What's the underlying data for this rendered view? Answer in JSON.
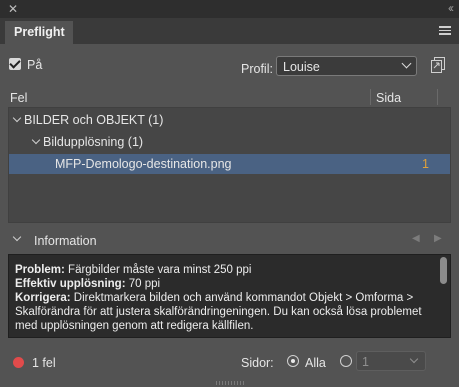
{
  "panel": {
    "tab_title": "Preflight"
  },
  "controls": {
    "on_label": "På",
    "profile_label": "Profil:",
    "profile_value": "Louise"
  },
  "table": {
    "col_error": "Fel",
    "col_page": "Sida",
    "rows": [
      {
        "label": "BILDER och OBJEKT (1)",
        "page": ""
      },
      {
        "label": "Bildupplösning (1)",
        "page": ""
      },
      {
        "label": "MFP-Demologo-destination.png",
        "page": "1"
      }
    ]
  },
  "info": {
    "title": "Information",
    "problem_label": "Problem:",
    "problem_text": " Färgbilder måste vara minst 250 ppi",
    "eff_label": "Effektiv upplösning:",
    "eff_text": " 70 ppi",
    "fix_label": "Korrigera:",
    "fix_text": " Direktmarkera bilden och använd kommandot Objekt > Omforma > Skalförändra för att justera skalförändringeningen. Du kan också lösa problemet med upplösningen genom att redigera källfilen."
  },
  "footer": {
    "error_count": "1 fel",
    "pages_label": "Sidor:",
    "all_label": "Alla",
    "page_range_value": "1"
  },
  "colors": {
    "selection": "#4a6283",
    "page_number": "#e0a13a",
    "error_dot": "#e14b4b"
  }
}
